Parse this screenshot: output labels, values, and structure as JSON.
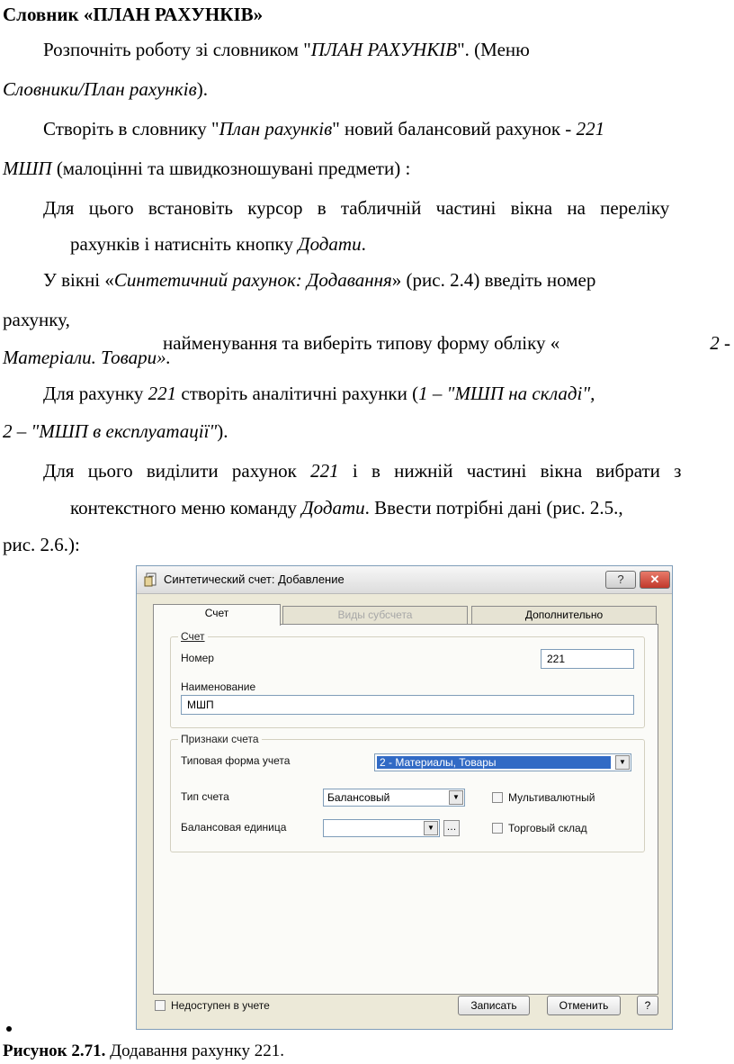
{
  "document": {
    "heading": "Словник «ПЛАН РАХУНКІВ»",
    "p1": {
      "a": "Розпочніть роботу зі словником \"",
      "b": "ПЛАН РАХУНКІВ",
      "c": "\". (Меню",
      "d": "Словники/План рахунків",
      "e": ")."
    },
    "p2": {
      "a": "Створіть в словнику \"",
      "b": "План рахунків",
      "c": "\" новий балансовий рахунок - ",
      "d": "221",
      "e": "МШП",
      "f": " (малоцінні та швидкозношувані предмети) :"
    },
    "p3": {
      "a": "Для цього встановіть курсор в табличній частині вікна на переліку",
      "b": "рахунків і натисніть кнопку ",
      "c": "Додати",
      "d": "."
    },
    "p4": {
      "a": "У вікні «",
      "b": "Синтетичний рахунок: Додавання",
      "c": "» (рис. 2.4) введіть номер",
      "d": "рахунку,",
      "e": "найменування та виберіть типову форму обліку «",
      "f": "2 -",
      "g": "Матеріали. Товари»."
    },
    "p5": {
      "a": "Для рахунку ",
      "b": "221",
      "c": " створіть аналітичні рахунки (",
      "d": "1 –  \"МШП на складі\",",
      "e": "2 – \"МШП в експлуатації\"",
      "f": ")."
    },
    "p6": {
      "a": "Для цього виділити рахунок ",
      "b": "221",
      "c": " і в нижній частині вікна вибрати з",
      "d": "контекстного меню команду ",
      "e": "Додати",
      "f": ". Ввести потрібні дані (рис. 2.5.,",
      "g": "рис. 2.6.):"
    },
    "caption": {
      "bold": "Рисунок 2.71.",
      "text": " Додавання рахунку 221."
    }
  },
  "dialog": {
    "title": "Синтетический счет: Добавление",
    "help_label": "?",
    "close_label": "✕",
    "tabs": [
      "Счет",
      "Виды субсчета",
      "Дополнительно"
    ],
    "group_account": "Счет",
    "number_label": "Номер",
    "number_value": "221",
    "name_label": "Наименование",
    "name_value": "МШП",
    "group_attrs": "Признаки счета",
    "form_label": "Типовая форма учета",
    "form_value": "2 - Материалы, Товары",
    "type_label": "Тип счета",
    "type_value": "Балансовый",
    "unit_label": "Балансовая единица",
    "unit_value": "",
    "multicurrency_label": "Мультивалютный",
    "warehouse_label": "Торговый склад",
    "unavailable_label": "Недоступен в учете",
    "save_label": "Записать",
    "cancel_label": "Отменить",
    "help2_label": "?"
  }
}
